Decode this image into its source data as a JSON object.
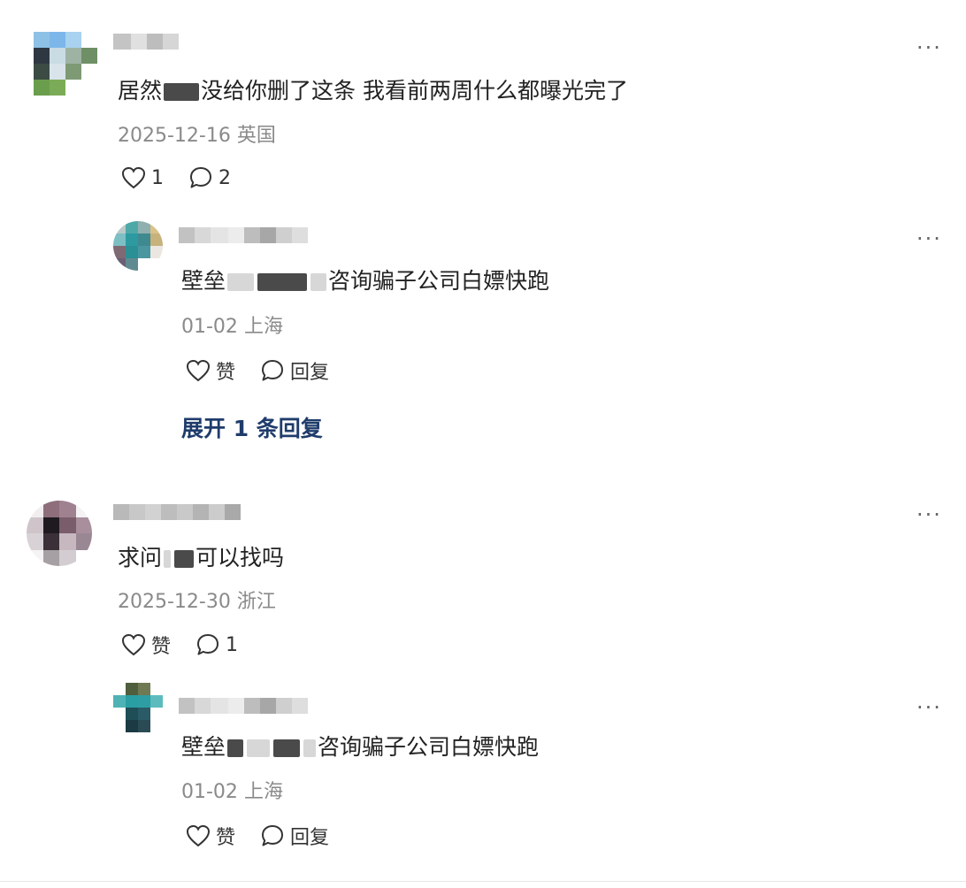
{
  "comments": [
    {
      "text_before": "居然",
      "text_after": "没给你删了这条 我看前两周什么都曝光完了",
      "date": "2025-12-16",
      "location": "英国",
      "like_label": "1",
      "reply_label": "2",
      "more": "···",
      "reply": {
        "text_before": "壁垒",
        "text_after": "咨询骗子公司白嫖快跑",
        "date": "01-02",
        "location": "上海",
        "like_label": "赞",
        "reply_label": "回复",
        "more": "···"
      },
      "expand_label": "展开 1 条回复"
    },
    {
      "text_before": "求问",
      "text_after": "可以找吗",
      "date": "2025-12-30",
      "location": "浙江",
      "like_label": "赞",
      "reply_label": "1",
      "more": "···",
      "reply": {
        "text_before": "壁垒",
        "text_after": "咨询骗子公司白嫖快跑",
        "date": "01-02",
        "location": "上海",
        "like_label": "赞",
        "reply_label": "回复",
        "more": "···"
      }
    }
  ],
  "icons": {
    "like": "heart-outline-icon",
    "reply": "speech-bubble-icon",
    "more": "more-dots-icon"
  },
  "colors": {
    "text": "#222222",
    "meta": "#8a8a8a",
    "expand_link": "#1f3c6b",
    "icon": "#333333"
  }
}
